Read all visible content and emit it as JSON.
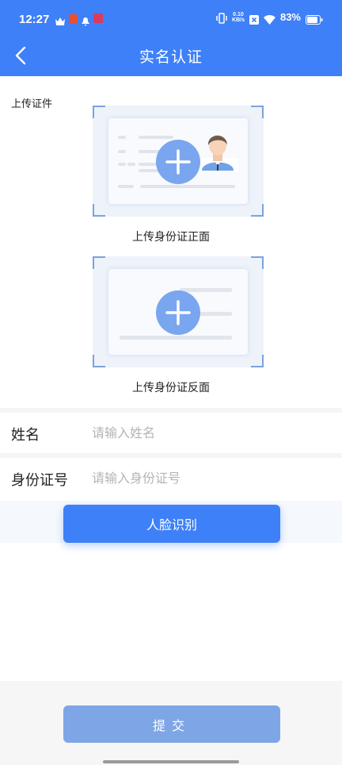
{
  "status_bar": {
    "time": "12:27",
    "net_speed_value": "0.10",
    "net_speed_unit": "KB/s",
    "battery": "83%"
  },
  "nav": {
    "title": "实名认证"
  },
  "upload": {
    "section_label": "上传证件",
    "front_caption": "上传身份证正面",
    "back_caption": "上传身份证反面"
  },
  "form": {
    "name_label": "姓名",
    "name_placeholder": "请输入姓名",
    "name_value": "",
    "id_label": "身份证号",
    "id_placeholder": "请输入身份证号",
    "id_value": ""
  },
  "face_button": "人脸识别",
  "submit_button": "提交",
  "colors": {
    "primary": "#3e80f7",
    "submit_disabled": "#7ea6e6",
    "placeholder": "#b5b5b5"
  }
}
